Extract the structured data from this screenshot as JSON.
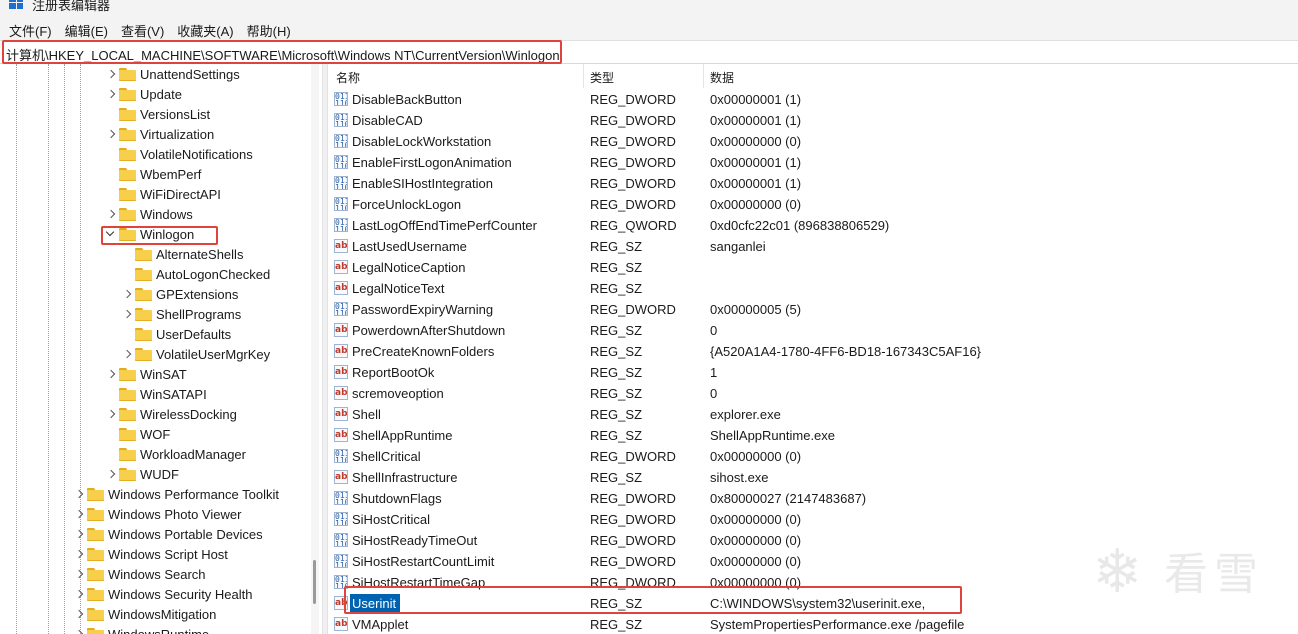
{
  "window": {
    "title": "注册表编辑器"
  },
  "menu": [
    {
      "label": "文件(F)"
    },
    {
      "label": "编辑(E)"
    },
    {
      "label": "查看(V)"
    },
    {
      "label": "收藏夹(A)"
    },
    {
      "label": "帮助(H)"
    }
  ],
  "address": {
    "path": "计算机\\HKEY_LOCAL_MACHINE\\SOFTWARE\\Microsoft\\Windows NT\\CurrentVersion\\Winlogon"
  },
  "tree": {
    "items": [
      {
        "label": "UnattendSettings",
        "expander": "right",
        "level": 1
      },
      {
        "label": "Update",
        "expander": "right",
        "level": 1
      },
      {
        "label": "VersionsList",
        "expander": "none",
        "level": 1
      },
      {
        "label": "Virtualization",
        "expander": "right",
        "level": 1
      },
      {
        "label": "VolatileNotifications",
        "expander": "none",
        "level": 1
      },
      {
        "label": "WbemPerf",
        "expander": "none",
        "level": 1
      },
      {
        "label": "WiFiDirectAPI",
        "expander": "none",
        "level": 1
      },
      {
        "label": "Windows",
        "expander": "right",
        "level": 1
      },
      {
        "label": "Winlogon",
        "expander": "down",
        "level": 1,
        "highlighted": true
      },
      {
        "label": "AlternateShells",
        "expander": "none",
        "level": 2
      },
      {
        "label": "AutoLogonChecked",
        "expander": "none",
        "level": 2
      },
      {
        "label": "GPExtensions",
        "expander": "right",
        "level": 2
      },
      {
        "label": "ShellPrograms",
        "expander": "right",
        "level": 2
      },
      {
        "label": "UserDefaults",
        "expander": "none",
        "level": 2
      },
      {
        "label": "VolatileUserMgrKey",
        "expander": "right",
        "level": 2
      },
      {
        "label": "WinSAT",
        "expander": "right",
        "level": 1
      },
      {
        "label": "WinSATAPI",
        "expander": "none",
        "level": 1
      },
      {
        "label": "WirelessDocking",
        "expander": "right",
        "level": 1
      },
      {
        "label": "WOF",
        "expander": "none",
        "level": 1
      },
      {
        "label": "WorkloadManager",
        "expander": "none",
        "level": 1
      },
      {
        "label": "WUDF",
        "expander": "right",
        "level": 1
      },
      {
        "label": "Windows Performance Toolkit",
        "expander": "right",
        "level": 0
      },
      {
        "label": "Windows Photo Viewer",
        "expander": "right",
        "level": 0
      },
      {
        "label": "Windows Portable Devices",
        "expander": "right",
        "level": 0
      },
      {
        "label": "Windows Script Host",
        "expander": "right",
        "level": 0
      },
      {
        "label": "Windows Search",
        "expander": "right",
        "level": 0
      },
      {
        "label": "Windows Security Health",
        "expander": "right",
        "level": 0
      },
      {
        "label": "WindowsMitigation",
        "expander": "right",
        "level": 0
      },
      {
        "label": "WindowsRuntime",
        "expander": "right",
        "level": 0
      }
    ]
  },
  "values": {
    "headers": {
      "name": "名称",
      "type": "类型",
      "data": "数据"
    },
    "rows": [
      {
        "icon": "dword",
        "name": "DisableBackButton",
        "type": "REG_DWORD",
        "data": "0x00000001 (1)"
      },
      {
        "icon": "dword",
        "name": "DisableCAD",
        "type": "REG_DWORD",
        "data": "0x00000001 (1)"
      },
      {
        "icon": "dword",
        "name": "DisableLockWorkstation",
        "type": "REG_DWORD",
        "data": "0x00000000 (0)"
      },
      {
        "icon": "dword",
        "name": "EnableFirstLogonAnimation",
        "type": "REG_DWORD",
        "data": "0x00000001 (1)"
      },
      {
        "icon": "dword",
        "name": "EnableSIHostIntegration",
        "type": "REG_DWORD",
        "data": "0x00000001 (1)"
      },
      {
        "icon": "dword",
        "name": "ForceUnlockLogon",
        "type": "REG_DWORD",
        "data": "0x00000000 (0)"
      },
      {
        "icon": "dword",
        "name": "LastLogOffEndTimePerfCounter",
        "type": "REG_QWORD",
        "data": "0xd0cfc22c01 (896838806529)"
      },
      {
        "icon": "sz",
        "name": "LastUsedUsername",
        "type": "REG_SZ",
        "data": "sanganlei"
      },
      {
        "icon": "sz",
        "name": "LegalNoticeCaption",
        "type": "REG_SZ",
        "data": ""
      },
      {
        "icon": "sz",
        "name": "LegalNoticeText",
        "type": "REG_SZ",
        "data": ""
      },
      {
        "icon": "dword",
        "name": "PasswordExpiryWarning",
        "type": "REG_DWORD",
        "data": "0x00000005 (5)"
      },
      {
        "icon": "sz",
        "name": "PowerdownAfterShutdown",
        "type": "REG_SZ",
        "data": "0"
      },
      {
        "icon": "sz",
        "name": "PreCreateKnownFolders",
        "type": "REG_SZ",
        "data": "{A520A1A4-1780-4FF6-BD18-167343C5AF16}"
      },
      {
        "icon": "sz",
        "name": "ReportBootOk",
        "type": "REG_SZ",
        "data": "1"
      },
      {
        "icon": "sz",
        "name": "scremoveoption",
        "type": "REG_SZ",
        "data": "0"
      },
      {
        "icon": "sz",
        "name": "Shell",
        "type": "REG_SZ",
        "data": "explorer.exe"
      },
      {
        "icon": "sz",
        "name": "ShellAppRuntime",
        "type": "REG_SZ",
        "data": "ShellAppRuntime.exe"
      },
      {
        "icon": "dword",
        "name": "ShellCritical",
        "type": "REG_DWORD",
        "data": "0x00000000 (0)"
      },
      {
        "icon": "sz",
        "name": "ShellInfrastructure",
        "type": "REG_SZ",
        "data": "sihost.exe"
      },
      {
        "icon": "dword",
        "name": "ShutdownFlags",
        "type": "REG_DWORD",
        "data": "0x80000027 (2147483687)"
      },
      {
        "icon": "dword",
        "name": "SiHostCritical",
        "type": "REG_DWORD",
        "data": "0x00000000 (0)"
      },
      {
        "icon": "dword",
        "name": "SiHostReadyTimeOut",
        "type": "REG_DWORD",
        "data": "0x00000000 (0)"
      },
      {
        "icon": "dword",
        "name": "SiHostRestartCountLimit",
        "type": "REG_DWORD",
        "data": "0x00000000 (0)"
      },
      {
        "icon": "dword",
        "name": "SiHostRestartTimeGap",
        "type": "REG_DWORD",
        "data": "0x00000000 (0)"
      },
      {
        "icon": "sz",
        "name": "Userinit",
        "type": "REG_SZ",
        "data": "C:\\WINDOWS\\system32\\userinit.exe,",
        "selected": true
      },
      {
        "icon": "sz",
        "name": "VMApplet",
        "type": "REG_SZ",
        "data": "SystemPropertiesPerformance.exe /pagefile"
      }
    ]
  },
  "watermark": {
    "text": "看雪"
  },
  "colors": {
    "highlight_box": "#e0423c",
    "selection": "#0063b1",
    "folder": "#f8cf4a"
  }
}
